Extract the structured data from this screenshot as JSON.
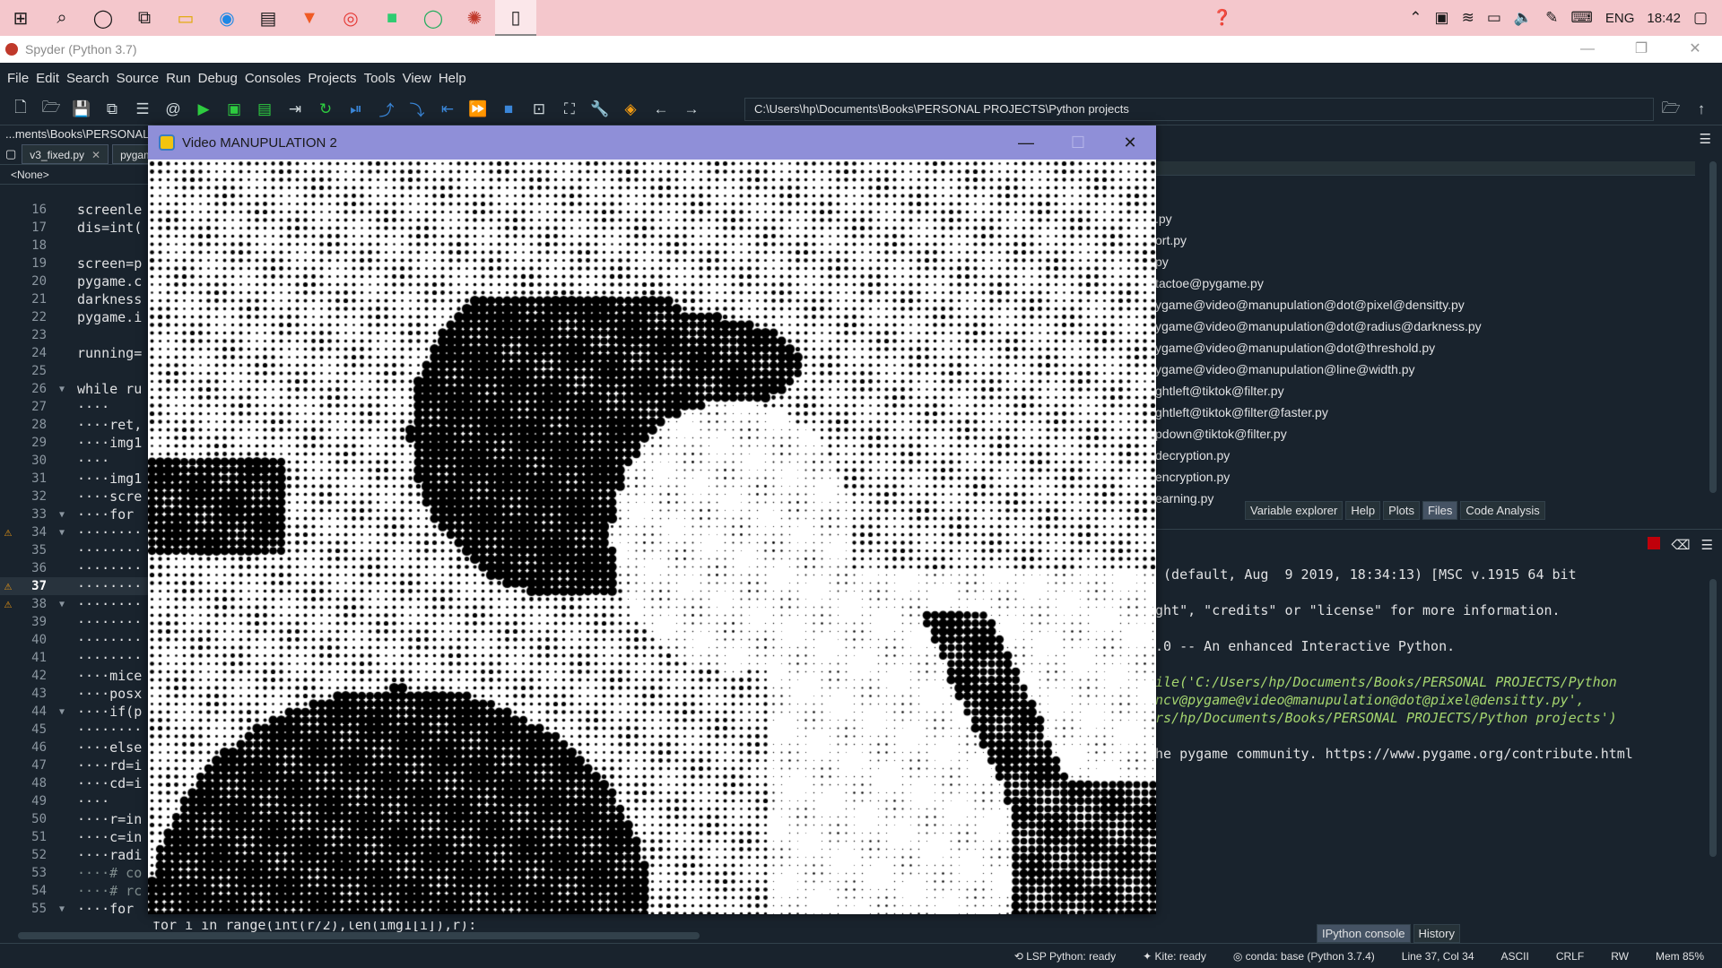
{
  "taskbar": {
    "icons": [
      "windows-start-icon",
      "search-icon",
      "cortana-icon",
      "task-view-icon",
      "file-explorer-icon",
      "edge-icon",
      "store-icon",
      "brave-icon",
      "chrome-icon",
      "whatsapp-icon",
      "spotify-icon",
      "app-icon",
      "blank-doc-icon"
    ],
    "language": "ENG",
    "time": "18:42"
  },
  "window": {
    "title": "Spyder (Python 3.7)",
    "controls": {
      "minimize": "—",
      "maximize": "❐",
      "close": "✕"
    }
  },
  "menu": [
    "File",
    "Edit",
    "Search",
    "Source",
    "Run",
    "Debug",
    "Consoles",
    "Projects",
    "Tools",
    "View",
    "Help"
  ],
  "toolbar": {
    "path": "C:\\Users\\hp\\Documents\\Books\\PERSONAL PROJECTS\\Python projects"
  },
  "editor": {
    "path_fragment": "...ments\\Books\\PERSONAL P",
    "tabs": [
      {
        "label": "v3_fixed.py",
        "close": "✕"
      },
      {
        "label": "pygam"
      }
    ],
    "outline_selector": "<None>",
    "lines": [
      {
        "n": "16",
        "text": "screenle",
        "fold": "",
        "warn": false
      },
      {
        "n": "17",
        "text": "dis=int(",
        "fold": "",
        "warn": false
      },
      {
        "n": "18",
        "text": "",
        "fold": "",
        "warn": false
      },
      {
        "n": "19",
        "text": "screen=p",
        "fold": "",
        "warn": false
      },
      {
        "n": "20",
        "text": "pygame.c",
        "fold": "",
        "warn": false
      },
      {
        "n": "21",
        "text": "darkness",
        "fold": "",
        "warn": false
      },
      {
        "n": "22",
        "text": "pygame.i",
        "fold": "",
        "warn": false
      },
      {
        "n": "23",
        "text": "",
        "fold": "",
        "warn": false
      },
      {
        "n": "24",
        "text": "running=",
        "fold": "",
        "warn": false
      },
      {
        "n": "25",
        "text": "",
        "fold": "",
        "warn": false
      },
      {
        "n": "26",
        "text": "while ru",
        "fold": "▼",
        "warn": false
      },
      {
        "n": "27",
        "text": "····",
        "fold": "",
        "warn": false
      },
      {
        "n": "28",
        "text": "····ret,",
        "fold": "",
        "warn": false
      },
      {
        "n": "29",
        "text": "····img1",
        "fold": "",
        "warn": false
      },
      {
        "n": "30",
        "text": "····",
        "fold": "",
        "warn": false
      },
      {
        "n": "31",
        "text": "····img1",
        "fold": "",
        "warn": false
      },
      {
        "n": "32",
        "text": "····scre",
        "fold": "",
        "warn": false
      },
      {
        "n": "33",
        "text": "····for ",
        "fold": "▼",
        "warn": false
      },
      {
        "n": "34",
        "text": "········",
        "fold": "▼",
        "warn": true
      },
      {
        "n": "35",
        "text": "········",
        "fold": "",
        "warn": false
      },
      {
        "n": "36",
        "text": "········",
        "fold": "",
        "warn": false
      },
      {
        "n": "37",
        "text": "········",
        "fold": "",
        "warn": true,
        "current": true
      },
      {
        "n": "38",
        "text": "········",
        "fold": "▼",
        "warn": true
      },
      {
        "n": "39",
        "text": "········",
        "fold": "",
        "warn": false
      },
      {
        "n": "40",
        "text": "········",
        "fold": "",
        "warn": false
      },
      {
        "n": "41",
        "text": "········",
        "fold": "",
        "warn": false
      },
      {
        "n": "42",
        "text": "····mice",
        "fold": "",
        "warn": false
      },
      {
        "n": "43",
        "text": "····posx",
        "fold": "",
        "warn": false
      },
      {
        "n": "44",
        "text": "····if(p",
        "fold": "▼",
        "warn": false
      },
      {
        "n": "45",
        "text": "········",
        "fold": "",
        "warn": false
      },
      {
        "n": "46",
        "text": "····else",
        "fold": "",
        "warn": false
      },
      {
        "n": "47",
        "text": "····rd=i",
        "fold": "",
        "warn": false
      },
      {
        "n": "48",
        "text": "····cd=i",
        "fold": "",
        "warn": false
      },
      {
        "n": "49",
        "text": "····",
        "fold": "",
        "warn": false
      },
      {
        "n": "50",
        "text": "····r=in",
        "fold": "",
        "warn": false
      },
      {
        "n": "51",
        "text": "····c=in",
        "fold": "",
        "warn": false
      },
      {
        "n": "52",
        "text": "····radi",
        "fold": "",
        "warn": false
      },
      {
        "n": "53",
        "text": "····# co",
        "fold": "",
        "warn": false
      },
      {
        "n": "54",
        "text": "····# rc",
        "fold": "",
        "warn": false
      },
      {
        "n": "55",
        "text": "····for ",
        "fold": "▼",
        "warn": false
      }
    ],
    "partial_bottom_line": "for i in range(int(r/2),len(img1[i]),r):"
  },
  "files": {
    "items": [
      ".py",
      "ort.py",
      "py",
      "tactoe@pygame.py",
      "ygame@video@manupulation@dot@pixel@densitty.py",
      "ygame@video@manupulation@dot@radius@darkness.py",
      "ygame@video@manupulation@dot@threshold.py",
      "ygame@video@manupulation@line@width.py",
      "ghtleft@tiktok@filter.py",
      "ghtleft@tiktok@filter@faster.py",
      "pdown@tiktok@filter.py",
      "decryption.py",
      "encryption.py",
      "earning.py"
    ],
    "pane_tabs": [
      "Variable explorer",
      "Help",
      "Plots",
      "Files",
      "Code Analysis"
    ],
    "selected_tab": "Files"
  },
  "console": {
    "lines": [
      {
        "text": " (default, Aug  9 2019, 18:34:13) [MSC v.1915 64 bit",
        "style": ""
      },
      {
        "text": "",
        "style": "gap"
      },
      {
        "text": "ght\", \"credits\" or \"license\" for more information.",
        "style": ""
      },
      {
        "text": "",
        "style": "gap"
      },
      {
        "text": ".0 -- An enhanced Interactive Python.",
        "style": ""
      },
      {
        "text": "",
        "style": "gap"
      },
      {
        "text": "ile('C:/Users/hp/Documents/Books/PERSONAL PROJECTS/Python",
        "style": "str"
      },
      {
        "text": "ncv@pygame@video@manupulation@dot@pixel@densitty.py',",
        "style": "str"
      },
      {
        "text": "rs/hp/Documents/Books/PERSONAL PROJECTS/Python projects')",
        "style": "str"
      },
      {
        "text": "",
        "style": "gap"
      },
      {
        "text": "he pygame community. https://www.pygame.org/contribute.html",
        "style": ""
      }
    ],
    "tabs": [
      "IPython console",
      "History"
    ],
    "selected_tab": "IPython console"
  },
  "status": {
    "lsp": "LSP Python: ready",
    "kite": "Kite: ready",
    "conda": "conda: base (Python 3.7.4)",
    "position": "Line 37, Col 34",
    "encoding": "ASCII",
    "eol": "CRLF",
    "perm": "RW",
    "mem": "Mem 85%"
  },
  "pygame_window": {
    "title": "Video MANUPULATION 2",
    "controls": {
      "minimize": "—",
      "maximize": "☐",
      "close": "✕"
    },
    "description_colors": {
      "ink": "#000000",
      "paper": "#ffffff"
    }
  },
  "colors": {
    "background": "#19232d",
    "taskbar": "#f4c7cc",
    "pygame_title": "#8f8fd8",
    "warning": "#f39c12",
    "run_green": "#2ecc40"
  }
}
